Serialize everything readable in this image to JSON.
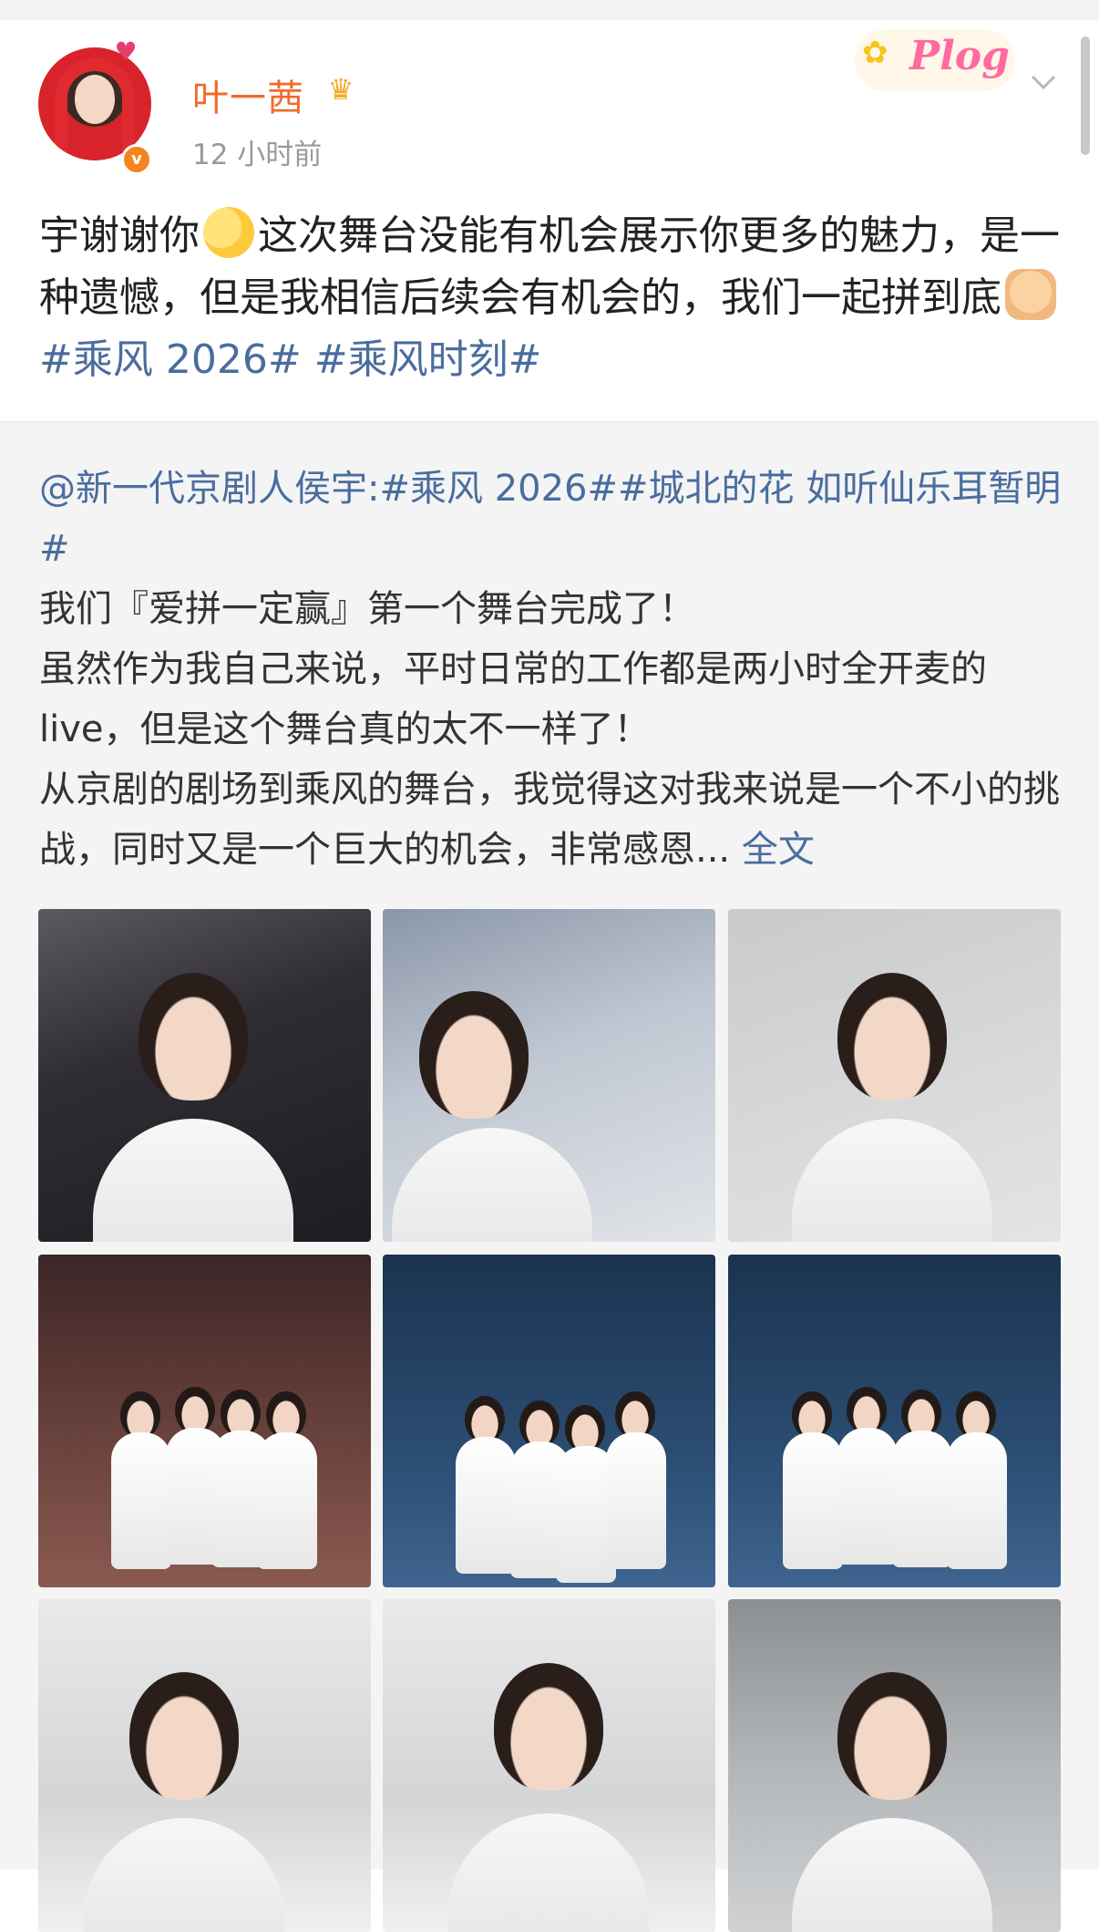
{
  "post": {
    "username": "叶一茜",
    "timestamp": "12 小时前",
    "sticker_text": "Plog",
    "text_part1": "宇谢谢你",
    "text_part2": "这次舞台没能有机会展示你更多的魅力，是一种遗憾，但是我相信后续会有机会的，我们一起拼到底",
    "hashtag1": "#乘风 2026#",
    "hashtag2": "#乘风时刻#",
    "icons": {
      "crown": "crown-icon",
      "verified": "verified-badge-icon",
      "menu": "chevron-down-icon",
      "emoji1": "blush-emoji-icon",
      "emoji2": "fist-emoji-icon"
    }
  },
  "repost": {
    "mention": "@新一代京剧人侯宇:#乘风 2026##城北的花 如听仙乐耳暂明#",
    "line1": "我们『爱拼一定赢』第一个舞台完成了！",
    "line2": "虽然作为我自己来说，平时日常的工作都是两小时全开麦的 live，但是这个舞台真的太不一样了！",
    "line3": "从京剧的剧场到乘风的舞台，我觉得这对我来说是一个不小的挑战，同时又是一个巨大的机会，非常感恩...",
    "full_text_link": "全文",
    "photos": [
      {
        "name": "photo-portrait-stage-lights"
      },
      {
        "name": "photo-backstage-smiling"
      },
      {
        "name": "photo-portrait-grey-wall"
      },
      {
        "name": "photo-group-four-red-stage"
      },
      {
        "name": "photo-group-heart-pose"
      },
      {
        "name": "photo-group-four-blue-stage"
      },
      {
        "name": "photo-portrait-corridor-1"
      },
      {
        "name": "photo-portrait-corridor-2"
      },
      {
        "name": "photo-portrait-corridor-3"
      }
    ]
  },
  "colors": {
    "username": "#f26b2b",
    "link": "#4a6d9e",
    "timestamp": "#9a9a9a",
    "repost_bg": "#f4f4f5"
  }
}
